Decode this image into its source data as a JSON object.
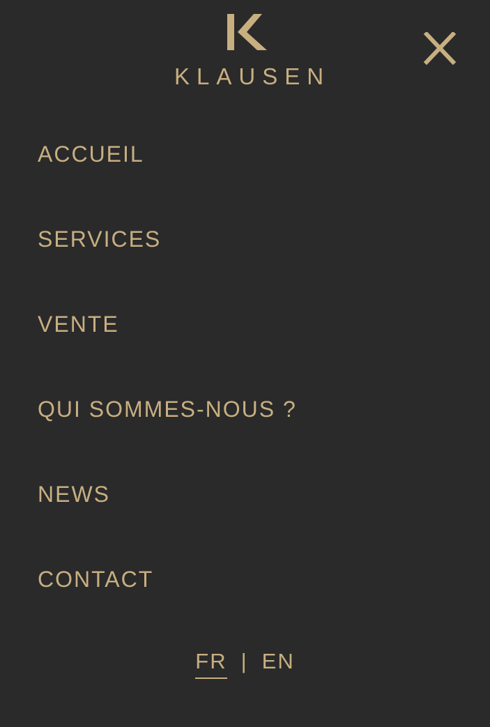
{
  "brand": {
    "name": "KLAUSEN",
    "mark": "K",
    "accent_color": "#c8af80",
    "background_color": "#2a2a2b"
  },
  "header": {
    "close_icon": "close-icon"
  },
  "menu": {
    "items": [
      {
        "label": "ACCUEIL"
      },
      {
        "label": "SERVICES"
      },
      {
        "label": "VENTE"
      },
      {
        "label": "QUI SOMMES-NOUS ?"
      },
      {
        "label": "NEWS"
      },
      {
        "label": "CONTACT"
      }
    ]
  },
  "language": {
    "options": [
      {
        "label": "FR",
        "active": true
      },
      {
        "label": "EN",
        "active": false
      }
    ],
    "separator": "|"
  }
}
